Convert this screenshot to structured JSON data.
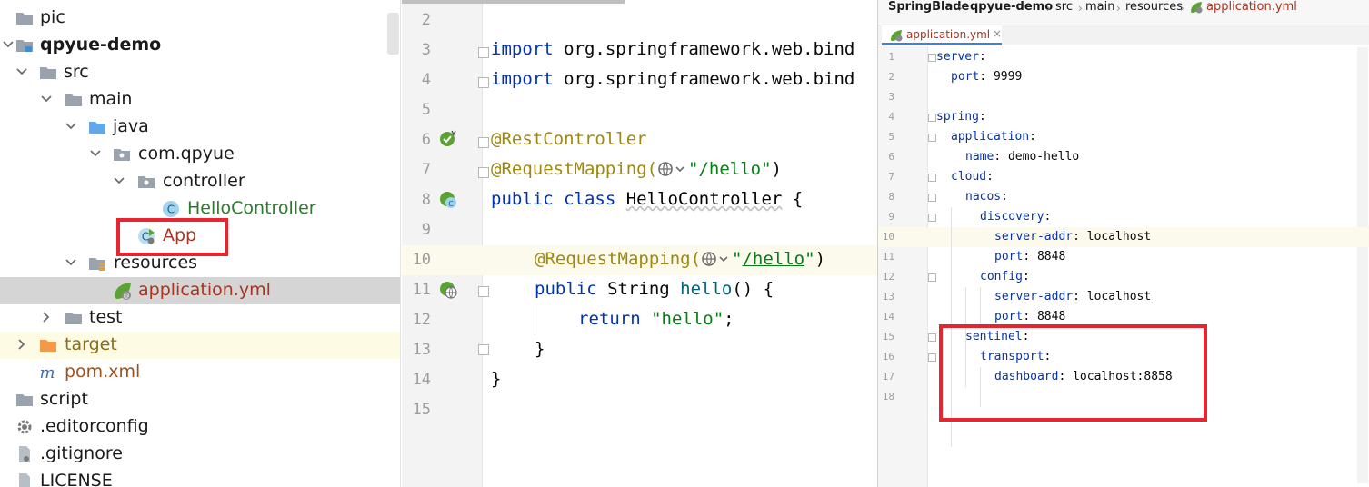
{
  "project_tree": {
    "items": [
      {
        "label": "pic",
        "icon": "folder-icon"
      },
      {
        "label": "qpyue-demo",
        "icon": "module-folder-icon"
      },
      {
        "label": "src",
        "icon": "folder-icon"
      },
      {
        "label": "main",
        "icon": "folder-icon"
      },
      {
        "label": "java",
        "icon": "source-folder-icon"
      },
      {
        "label": "com.qpyue",
        "icon": "package-icon"
      },
      {
        "label": "controller",
        "icon": "package-icon"
      },
      {
        "label": "HelloController",
        "icon": "class-icon"
      },
      {
        "label": "App",
        "icon": "spring-boot-class-icon"
      },
      {
        "label": "resources",
        "icon": "resources-folder-icon"
      },
      {
        "label": "application.yml",
        "icon": "spring-yaml-icon"
      },
      {
        "label": "test",
        "icon": "folder-icon"
      },
      {
        "label": "target",
        "icon": "excluded-folder-icon"
      },
      {
        "label": "pom.xml",
        "icon": "maven-icon"
      },
      {
        "label": "script",
        "icon": "folder-icon"
      },
      {
        "label": ".editorconfig",
        "icon": "gear-icon"
      },
      {
        "label": ".gitignore",
        "icon": "file-icon"
      },
      {
        "label": "LICENSE",
        "icon": "file-icon"
      }
    ]
  },
  "editor": {
    "line_numbers": [
      "2",
      "3",
      "4",
      "5",
      "6",
      "7",
      "8",
      "9",
      "10",
      "11",
      "12",
      "13",
      "14",
      "15"
    ],
    "code": {
      "l3_kw": "import",
      "l3_rest": " org.springframework.web.bind",
      "l4_kw": "import",
      "l4_rest": " org.springframework.web.bind",
      "l6_ann": "@RestController",
      "l7_ann": "@RequestMapping(",
      "l7_str": "\"/hello\"",
      "l7_close": ")",
      "l8_kw": "public class",
      "l8_cls": "HelloController",
      "l8_brace": " {",
      "l10_ann": "@RequestMapping(",
      "l10_q1": "\"",
      "l10_path": "/hello",
      "l10_q2": "\"",
      "l10_close": ")",
      "l11_kw": "public",
      "l11_type": " String ",
      "l11_fn": "hello",
      "l11_rest": "() {",
      "l12_kw": "return",
      "l12_str": " \"hello\"",
      "l12_semi": ";",
      "l13": "}",
      "l14": "}"
    }
  },
  "yaml_panel": {
    "breadcrumbs": [
      "SpringBlade",
      "qpyue-demo",
      "src",
      "main",
      "resources",
      "application.yml"
    ],
    "tab_label": "application.yml",
    "tab_close": "×",
    "line_numbers": [
      "1",
      "2",
      "3",
      "4",
      "5",
      "6",
      "7",
      "8",
      "9",
      "10",
      "11",
      "12",
      "13",
      "14",
      "15",
      "16",
      "17",
      "18"
    ],
    "lines": [
      {
        "key": "server",
        "value": ""
      },
      {
        "key": "port",
        "value": "9999"
      },
      {
        "key": "",
        "value": ""
      },
      {
        "key": "spring",
        "value": ""
      },
      {
        "key": "application",
        "value": ""
      },
      {
        "key": "name",
        "value": "demo-hello"
      },
      {
        "key": "cloud",
        "value": ""
      },
      {
        "key": "nacos",
        "value": ""
      },
      {
        "key": "discovery",
        "value": ""
      },
      {
        "key": "server-addr",
        "value": "localhost"
      },
      {
        "key": "port",
        "value": "8848"
      },
      {
        "key": "config",
        "value": ""
      },
      {
        "key": "server-addr",
        "value": "localhost"
      },
      {
        "key": "port",
        "value": "8848"
      },
      {
        "key": "sentinel",
        "value": ""
      },
      {
        "key": "transport",
        "value": ""
      },
      {
        "key": "dashboard",
        "value": "localhost:8858"
      },
      {
        "key": "",
        "value": ""
      }
    ]
  },
  "colors": {
    "highlight_box": "#e8252f",
    "keyword": "#0033b3",
    "annotation": "#9e880d",
    "string": "#067d17",
    "selection": "#d5d5d5"
  }
}
